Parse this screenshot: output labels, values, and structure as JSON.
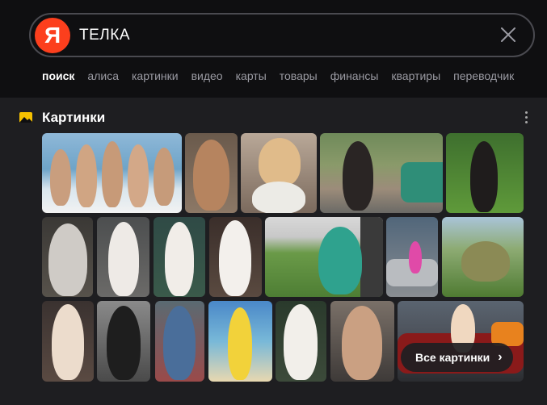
{
  "search": {
    "query": "ТЕЛКА",
    "logo": "Я"
  },
  "tabs": [
    "поиск",
    "алиса",
    "картинки",
    "видео",
    "карты",
    "товары",
    "финансы",
    "квартиры",
    "переводчик"
  ],
  "active_tab": "поиск",
  "section": {
    "title": "Картинки",
    "icon": "images-icon"
  },
  "all_images_button": {
    "label": "Все картинки",
    "icon": "chevron-right-icon"
  },
  "colors": {
    "background": "#1e1e21",
    "topbar": "#0f0f11",
    "yandex_red": "#fc3f1d",
    "section_icon": "#f5c000"
  }
}
